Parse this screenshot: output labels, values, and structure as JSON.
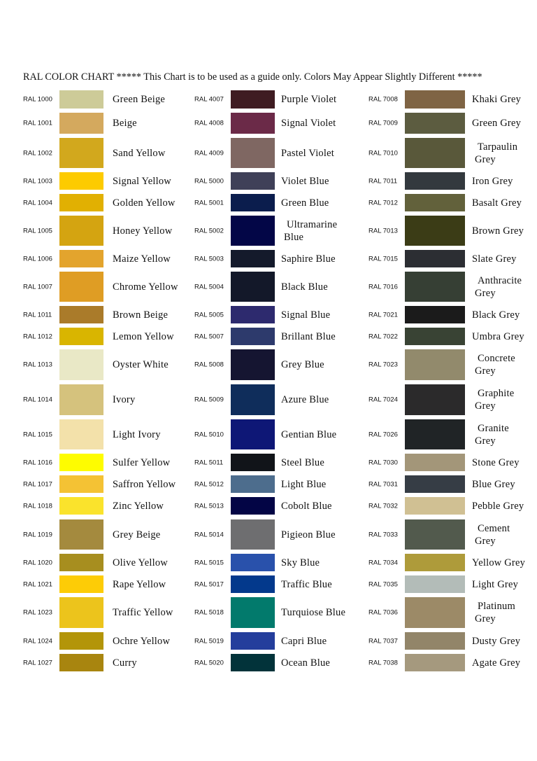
{
  "title": "RAL COLOR CHART *****  This Chart is to be used as a guide only. Colors May Appear Slightly Different *****",
  "columns": [
    {
      "entries": [
        {
          "code": "RAL 1000",
          "name": "Green Beige",
          "color": "#cdcb98"
        },
        {
          "code": "RAL 1001",
          "name": "Beige",
          "color": "#d4a95e"
        },
        {
          "code": "RAL 1002",
          "name": "Sand Yellow",
          "color": "#d2a81d"
        },
        {
          "code": "RAL 1003",
          "name": "Signal Yellow",
          "color": "#fdcb00"
        },
        {
          "code": "RAL 1004",
          "name": "Golden Yellow",
          "color": "#e1b002"
        },
        {
          "code": "RAL 1005",
          "name": "Honey Yellow",
          "color": "#d4a411"
        },
        {
          "code": "RAL 1006",
          "name": "Maize Yellow",
          "color": "#e3a42d"
        },
        {
          "code": "RAL 1007",
          "name": "Chrome Yellow",
          "color": "#df9d24"
        },
        {
          "code": "RAL 1011",
          "name": "Brown Beige",
          "color": "#aa7b2a"
        },
        {
          "code": "RAL 1012",
          "name": "Lemon Yellow",
          "color": "#d9b500"
        },
        {
          "code": "RAL 1013",
          "name": "Oyster White",
          "color": "#e9e8c6"
        },
        {
          "code": "RAL 1014",
          "name": "Ivory",
          "color": "#d5c27d"
        },
        {
          "code": "RAL 1015",
          "name": "Light Ivory",
          "color": "#f3e1aa"
        },
        {
          "code": "RAL 1016",
          "name": "Sulfer Yellow",
          "color": "#fefc00"
        },
        {
          "code": "RAL 1017",
          "name": "Saffron Yellow",
          "color": "#f4c234"
        },
        {
          "code": "RAL 1018",
          "name": "Zinc Yellow",
          "color": "#fae32c"
        },
        {
          "code": "RAL 1019",
          "name": "Grey Beige",
          "color": "#a48a3e"
        },
        {
          "code": "RAL 1020",
          "name": "Olive Yellow",
          "color": "#a78e1f"
        },
        {
          "code": "RAL 1021",
          "name": "Rape Yellow",
          "color": "#fdcc06"
        },
        {
          "code": "RAL 1023",
          "name": "Traffic Yellow",
          "color": "#ecc41c"
        },
        {
          "code": "RAL 1024",
          "name": "Ochre Yellow",
          "color": "#b39509"
        },
        {
          "code": "RAL 1027",
          "name": "Curry",
          "color": "#a8850f"
        }
      ]
    },
    {
      "entries": [
        {
          "code": "RAL 4007",
          "name": "Purple Violet",
          "color": "#3f1c22"
        },
        {
          "code": "RAL 4008",
          "name": "Signal Violet",
          "color": "#6b2a48"
        },
        {
          "code": "RAL 4009",
          "name": "Pastel Violet",
          "color": "#7f6762"
        },
        {
          "code": "RAL 5000",
          "name": "Violet Blue",
          "color": "#3f4058"
        },
        {
          "code": "RAL 5001",
          "name": "Green Blue",
          "color": "#0b1d4d"
        },
        {
          "code": "RAL 5002",
          "name": "Ultramarine Blue",
          "color": "#030647"
        },
        {
          "code": "RAL 5003",
          "name": "Saphire Blue",
          "color": "#141a2b"
        },
        {
          "code": "RAL 5004",
          "name": "Black Blue",
          "color": "#131829"
        },
        {
          "code": "RAL 5005",
          "name": "Signal Blue",
          "color": "#2d2a6e"
        },
        {
          "code": "RAL 5007",
          "name": "Brillant Blue",
          "color": "#2d3a6c"
        },
        {
          "code": "RAL 5008",
          "name": "Grey Blue",
          "color": "#151531"
        },
        {
          "code": "RAL 5009",
          "name": "Azure Blue",
          "color": "#0f2d5b"
        },
        {
          "code": "RAL 5010",
          "name": "Gentian Blue",
          "color": "#0e1776"
        },
        {
          "code": "RAL 5011",
          "name": "Steel Blue",
          "color": "#111419"
        },
        {
          "code": "RAL 5012",
          "name": "Light Blue",
          "color": "#4d6d8d"
        },
        {
          "code": "RAL 5013",
          "name": "Cobolt Blue",
          "color": "#030545"
        },
        {
          "code": "RAL 5014",
          "name": "Pigieon Blue",
          "color": "#6e6e70"
        },
        {
          "code": "RAL 5015",
          "name": "Sky Blue",
          "color": "#2951ab"
        },
        {
          "code": "RAL 5017",
          "name": "Traffic Blue",
          "color": "#03398c"
        },
        {
          "code": "RAL 5018",
          "name": "Turquiose Blue",
          "color": "#027a6c"
        },
        {
          "code": "RAL 5019",
          "name": "Capri Blue",
          "color": "#243e9c"
        },
        {
          "code": "RAL 5020",
          "name": "Ocean Blue",
          "color": "#02333a"
        }
      ]
    },
    {
      "entries": [
        {
          "code": "RAL 7008",
          "name": "Khaki Grey",
          "color": "#7f6444"
        },
        {
          "code": "RAL 7009",
          "name": "Green Grey",
          "color": "#5c5c40"
        },
        {
          "code": "RAL 7010",
          "name": "Tarpaulin Grey",
          "color": "#59583a"
        },
        {
          "code": "RAL 7011",
          "name": "Iron Grey",
          "color": "#33393e"
        },
        {
          "code": "RAL 7012",
          "name": "Basalt Grey",
          "color": "#62613b"
        },
        {
          "code": "RAL 7013",
          "name": "Brown Grey",
          "color": "#3b3c16"
        },
        {
          "code": "RAL 7015",
          "name": "Slate Grey",
          "color": "#2c2e33"
        },
        {
          "code": "RAL 7016",
          "name": "Anthracite Grey",
          "color": "#363f34"
        },
        {
          "code": "RAL 7021",
          "name": "Black Grey",
          "color": "#1b1b1b"
        },
        {
          "code": "RAL 7022",
          "name": "Umbra Grey",
          "color": "#394334"
        },
        {
          "code": "RAL 7023",
          "name": "Concrete Grey",
          "color": "#928a6c"
        },
        {
          "code": "RAL 7024",
          "name": "Graphite Grey",
          "color": "#2b2a2b"
        },
        {
          "code": "RAL 7026",
          "name": "Granite Grey",
          "color": "#202426"
        },
        {
          "code": "RAL 7030",
          "name": "Stone Grey",
          "color": "#a39679"
        },
        {
          "code": "RAL 7031",
          "name": "Blue Grey",
          "color": "#363d45"
        },
        {
          "code": "RAL 7032",
          "name": "Pebble Grey",
          "color": "#d0c093"
        },
        {
          "code": "RAL 7033",
          "name": "Cement Grey",
          "color": "#525a4d"
        },
        {
          "code": "RAL 7034",
          "name": "Yellow Grey",
          "color": "#ae9b3a"
        },
        {
          "code": "RAL 7035",
          "name": "Light Grey",
          "color": "#b3bcb8"
        },
        {
          "code": "RAL 7036",
          "name": "Platinum Grey",
          "color": "#9c8a67"
        },
        {
          "code": "RAL 7037",
          "name": "Dusty Grey",
          "color": "#928569"
        },
        {
          "code": "RAL 7038",
          "name": "Agate Grey",
          "color": "#a5997e"
        }
      ]
    }
  ]
}
